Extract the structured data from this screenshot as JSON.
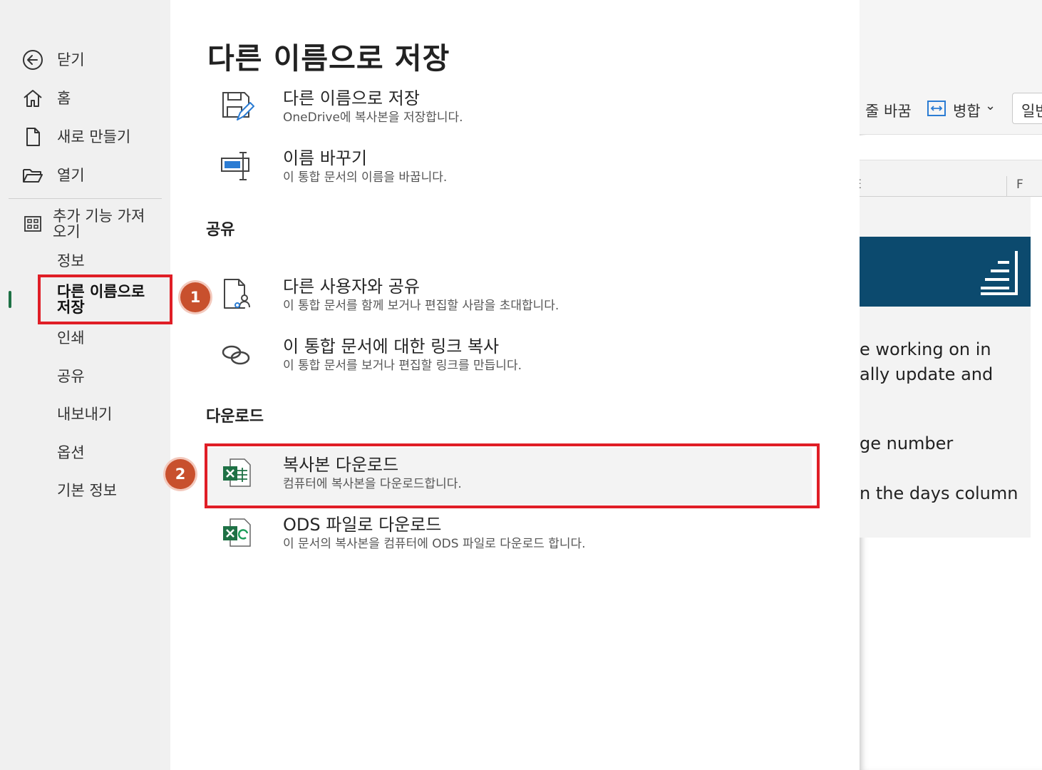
{
  "sidebar": {
    "items": [
      {
        "label": "닫기",
        "icon": "back-arrow-icon"
      },
      {
        "label": "홈",
        "icon": "home-icon"
      },
      {
        "label": "새로 만들기",
        "icon": "new-document-icon"
      },
      {
        "label": "열기",
        "icon": "open-folder-icon"
      },
      {
        "label": "추가 기능 가져\n오기",
        "icon": "addins-grid-icon"
      },
      {
        "label": "정보"
      },
      {
        "label": "다른 이름으로\n저장",
        "active": true
      },
      {
        "label": "인쇄"
      },
      {
        "label": "공유"
      },
      {
        "label": "내보내기"
      },
      {
        "label": "옵션"
      },
      {
        "label": "기본 정보"
      }
    ]
  },
  "main": {
    "title": "다른 이름으로 저장",
    "options": [
      {
        "title": "다른 이름으로 저장",
        "desc": "OneDrive에 복사본을 저장합니다.",
        "icon": "save-as-icon"
      },
      {
        "title": "이름 바꾸기",
        "desc": "이 통합 문서의 이름을 바꿉니다.",
        "icon": "rename-icon"
      }
    ],
    "share_section": {
      "title": "공유",
      "options": [
        {
          "title": "다른 사용자와 공유",
          "desc": "이 통합 문서를 함께 보거나 편집할 사람을 초대합니다.",
          "icon": "share-people-icon"
        },
        {
          "title": "이 통합 문서에 대한 링크 복사",
          "desc": "이 통합 문서를 보거나 편집할 링크를 만듭니다.",
          "icon": "link-icon"
        }
      ]
    },
    "download_section": {
      "title": "다운로드",
      "options": [
        {
          "title": "복사본 다운로드",
          "desc": "컴퓨터에 복사본을 다운로드합니다.",
          "icon": "excel-icon"
        },
        {
          "title": "ODS 파일로 다운로드",
          "desc": "이 문서의 복사본을 컴퓨터에 ODS 파일로 다운로드 합니다.",
          "icon": "excel-ods-icon"
        }
      ]
    }
  },
  "sheet": {
    "ribbon": {
      "wrap": "줄 바꿈",
      "merge": "병합",
      "format": "일반"
    },
    "column_label": "F",
    "column_label_partial": "E",
    "text_lines": [
      "e working on in",
      "ally update and",
      "ge number",
      "n the days column"
    ]
  },
  "annotations": {
    "step1": "1",
    "step2": "2"
  },
  "colors": {
    "accent_green": "#1e7145",
    "annotation_red": "#e01e26",
    "badge_orange": "#c8502d",
    "banner_blue": "#0c4a6e"
  }
}
